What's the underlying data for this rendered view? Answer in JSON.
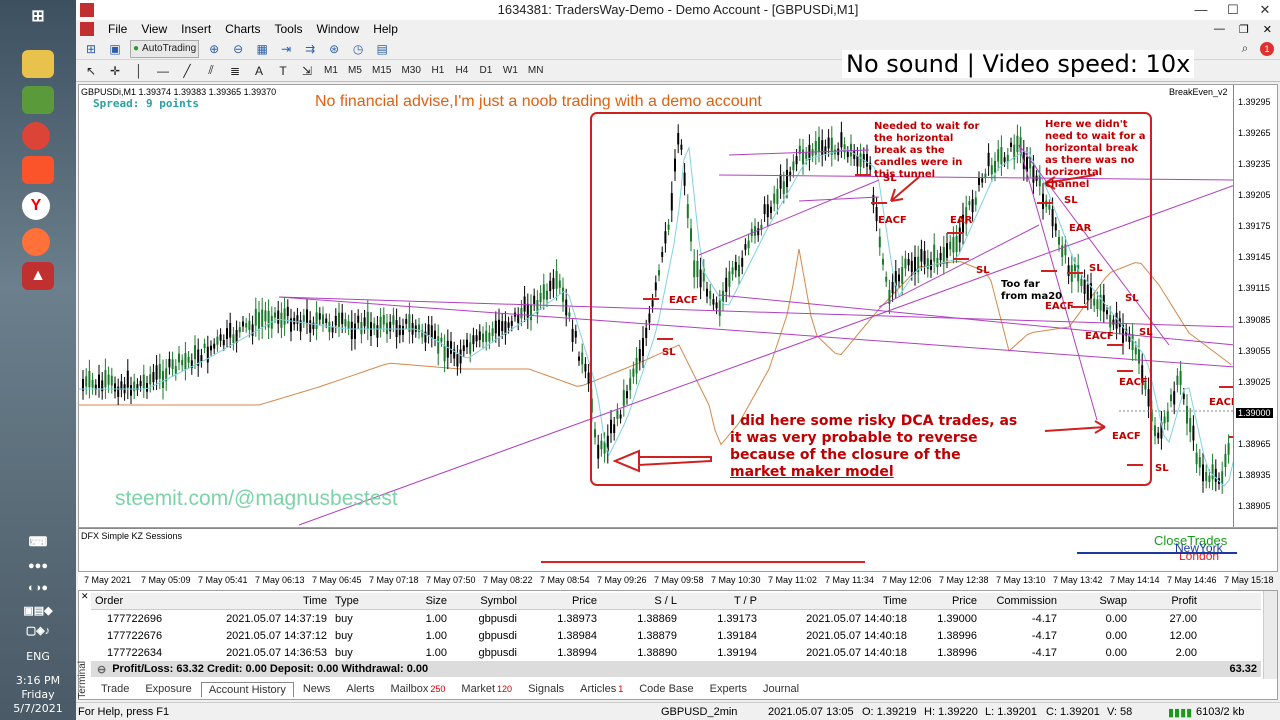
{
  "window": {
    "title": "1634381: TradersWay-Demo - Demo Account - [GBPUSDi,M1]"
  },
  "menu": [
    "File",
    "View",
    "Insert",
    "Charts",
    "Tools",
    "Window",
    "Help"
  ],
  "toolbar": {
    "autotrading": "AutoTrading",
    "timeframes": [
      "M1",
      "M5",
      "M15",
      "M30",
      "H1",
      "H4",
      "D1",
      "W1",
      "MN"
    ]
  },
  "overlay_caption": "No sound | Video speed: 10x",
  "chart": {
    "header": "GBPUSDi,M1  1.39374 1.39383 1.39365 1.39370",
    "spread": "Spread: 9 points",
    "disclaimer": "No financial advise,I'm just a noob trading with a demo account",
    "indicator": "BreakEven_v2",
    "watermark": "steemit.com/@magnusbestest",
    "price_labels": [
      "1.39295",
      "1.39265",
      "1.39235",
      "1.39205",
      "1.39175",
      "1.39145",
      "1.39115",
      "1.39085",
      "1.39055",
      "1.39025",
      "1.39000",
      "1.38965",
      "1.38935",
      "1.38905"
    ],
    "current_price": "1.39000",
    "note1": "Needed to wait for the horizontal break as the candles were in this tunnel",
    "note2": "Here we didn't need to wait for a horizontal break as there was no horizontal channel",
    "note3": "Too far from ma20",
    "note4_lines": [
      "I did here some risky DCA trades, as",
      "it was very probable to reverse",
      "because of the closure of the"
    ],
    "note4_underlined": "market maker model",
    "labels": {
      "sl": "SL",
      "eacf": "EACF",
      "ear": "EAR"
    }
  },
  "subwindow": {
    "title": "DFX Simple KZ Sessions",
    "close_trades": "CloseTrades",
    "newyork": "NewYork",
    "london": "London"
  },
  "time_axis": [
    "7 May 2021",
    "7 May 05:09",
    "7 May 05:41",
    "7 May 06:13",
    "7 May 06:45",
    "7 May 07:18",
    "7 May 07:50",
    "7 May 08:22",
    "7 May 08:54",
    "7 May 09:26",
    "7 May 09:58",
    "7 May 10:30",
    "7 May 11:02",
    "7 May 11:34",
    "7 May 12:06",
    "7 May 12:38",
    "7 May 13:10",
    "7 May 13:42",
    "7 May 14:14",
    "7 May 14:46",
    "7 May 15:18"
  ],
  "terminal": {
    "columns": [
      "Order",
      "Time",
      "Type",
      "Size",
      "Symbol",
      "Price",
      "S / L",
      "T / P",
      "Time",
      "Price",
      "Commission",
      "Swap",
      "Profit"
    ],
    "rows": [
      [
        "177722696",
        "2021.05.07 14:37:19",
        "buy",
        "1.00",
        "gbpusdi",
        "1.38973",
        "1.38869",
        "1.39173",
        "2021.05.07 14:40:18",
        "1.39000",
        "-4.17",
        "0.00",
        "27.00"
      ],
      [
        "177722676",
        "2021.05.07 14:37:12",
        "buy",
        "1.00",
        "gbpusdi",
        "1.38984",
        "1.38879",
        "1.39184",
        "2021.05.07 14:40:18",
        "1.38996",
        "-4.17",
        "0.00",
        "12.00"
      ],
      [
        "177722634",
        "2021.05.07 14:36:53",
        "buy",
        "1.00",
        "gbpusdi",
        "1.38994",
        "1.38890",
        "1.39194",
        "2021.05.07 14:40:18",
        "1.38996",
        "-4.17",
        "0.00",
        "2.00"
      ]
    ],
    "summary": "Profit/Loss: 63.32  Credit: 0.00  Deposit: 0.00  Withdrawal: 0.00",
    "summary_total": "63.32",
    "side_label": "Terminal"
  },
  "tabs": [
    {
      "label": "Trade",
      "badge": ""
    },
    {
      "label": "Exposure",
      "badge": ""
    },
    {
      "label": "Account History",
      "badge": ""
    },
    {
      "label": "News",
      "badge": ""
    },
    {
      "label": "Alerts",
      "badge": ""
    },
    {
      "label": "Mailbox",
      "badge": "250"
    },
    {
      "label": "Market",
      "badge": "120"
    },
    {
      "label": "Signals",
      "badge": ""
    },
    {
      "label": "Articles",
      "badge": "1"
    },
    {
      "label": "Code Base",
      "badge": ""
    },
    {
      "label": "Experts",
      "badge": ""
    },
    {
      "label": "Journal",
      "badge": ""
    }
  ],
  "status": {
    "help": "For Help, press F1",
    "profile": "GBPUSD_2min",
    "datetime": "2021.05.07 13:05",
    "o": "O: 1.39219",
    "h": "H: 1.39220",
    "l": "L: 1.39201",
    "c": "C: 1.39201",
    "v": "V: 58",
    "traffic": "6103/2 kb"
  },
  "system": {
    "lang": "ENG",
    "time": "3:16 PM",
    "day": "Friday",
    "date": "5/7/2021"
  },
  "colors": {
    "annotation": "#c00000",
    "watermark": "#6fcf9e",
    "bull": "#1a7a2a",
    "bear": "#000000",
    "ma": "#7fd3e0",
    "ma_slow": "#d4884a",
    "trend": "#b040c0"
  }
}
